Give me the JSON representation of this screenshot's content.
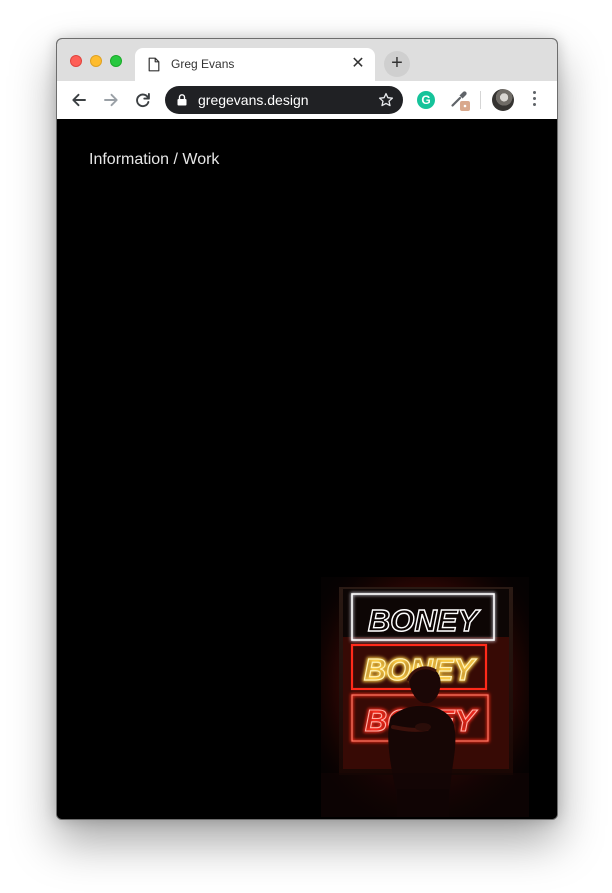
{
  "browser": {
    "tab": {
      "title": "Greg Evans",
      "close_glyph": "✕"
    },
    "new_tab_glyph": "+",
    "omnibox": {
      "url": "gregevans.design"
    },
    "extensions": {
      "grammarly_letter": "G"
    }
  },
  "page": {
    "nav": {
      "information": "Information",
      "separator": " / ",
      "work": "Work"
    },
    "photo": {
      "neon_sign_words": [
        "BONEY",
        "BONEY",
        "BONEY"
      ],
      "colors": {
        "neon_white": "#f3f1ff",
        "neon_yellow": "#ffcf45",
        "neon_red": "#ff2a1a"
      }
    }
  },
  "icons": {
    "back": "back-arrow-icon",
    "forward": "forward-arrow-icon",
    "reload": "reload-icon",
    "lock": "lock-icon",
    "star": "star-icon",
    "grammarly": "grammarly-icon",
    "color_picker": "color-picker-icon",
    "more": "more-vertical-icon"
  }
}
